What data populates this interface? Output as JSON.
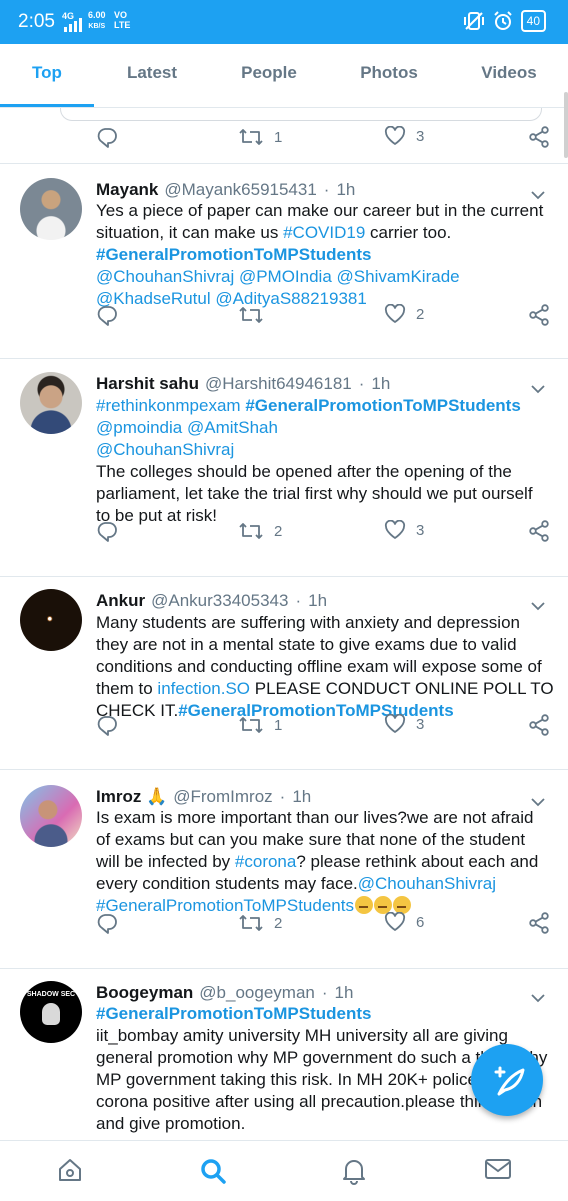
{
  "status_bar": {
    "time": "2:05",
    "network": "4G",
    "speed_value": "6.00",
    "speed_unit": "KB/S",
    "vo": "VO",
    "lte": "LTE",
    "battery": "40"
  },
  "tabs": [
    {
      "label": "Top",
      "active": true
    },
    {
      "label": "Latest",
      "active": false
    },
    {
      "label": "People",
      "active": false
    },
    {
      "label": "Photos",
      "active": false
    },
    {
      "label": "Videos",
      "active": false
    }
  ],
  "previous_tweet": {
    "retweets": "1",
    "likes": "3"
  },
  "tweets": [
    {
      "name": "Mayank",
      "handle": "@Mayank65915431",
      "time": "1h",
      "lines": [
        [
          {
            "t": "Yes a piece of paper can make our career but in the current"
          }
        ],
        [
          {
            "t": "situation, it can make us "
          },
          {
            "t": "#COVID19",
            "c": "ht"
          },
          {
            "t": " carrier too."
          }
        ],
        [
          {
            "t": "#GeneralPromotionToMPStudents",
            "c": "htb"
          }
        ],
        [
          {
            "t": "@ChouhanShivraj @PMOIndia @ShivamKirade",
            "c": "ht"
          }
        ],
        [
          {
            "t": "@KhadseRutul @AdityaS88219381",
            "c": "ht"
          }
        ]
      ],
      "retweets": "",
      "likes": "2"
    },
    {
      "name": "Harshit sahu",
      "handle": "@Harshit64946181",
      "time": "1h",
      "lines": [
        [
          {
            "t": "#rethinkonmpexam ",
            "c": "ht"
          },
          {
            "t": "#GeneralPromotionToMPStudents",
            "c": "htb"
          }
        ],
        [
          {
            "t": "@pmoindia @AmitShah",
            "c": "ht"
          }
        ],
        [
          {
            "t": "@ChouhanShivraj",
            "c": "ht"
          }
        ],
        [
          {
            "t": "The colleges should be opened after the opening of the"
          }
        ],
        [
          {
            "t": "parliament, let take the trial first why should we put ourself"
          }
        ],
        [
          {
            "t": "to be put at risk!"
          }
        ]
      ],
      "retweets": "2",
      "likes": "3"
    },
    {
      "name": "Ankur",
      "handle": "@Ankur33405343",
      "time": "1h",
      "lines": [
        [
          {
            "t": "Many students are suffering with anxiety and depression"
          }
        ],
        [
          {
            "t": "they are not in a mental state to give exams due to valid"
          }
        ],
        [
          {
            "t": "conditions and conducting offline exam will expose some of"
          }
        ],
        [
          {
            "t": "them to "
          },
          {
            "t": "infection.SO",
            "c": "ht"
          },
          {
            "t": " PLEASE CONDUCT ONLINE POLL TO"
          }
        ],
        [
          {
            "t": "CHECK IT."
          },
          {
            "t": "#GeneralPromotionToMPStudents",
            "c": "htb"
          }
        ]
      ],
      "retweets": "1",
      "likes": "3"
    },
    {
      "name": "Imroz 🙏",
      "handle": "@FromImroz",
      "time": "1h",
      "lines": [
        [
          {
            "t": "Is exam is more important than our lives?we are not afraid"
          }
        ],
        [
          {
            "t": "of exams but can you make sure that none of the student"
          }
        ],
        [
          {
            "t": "will be infected by "
          },
          {
            "t": "#corona",
            "c": "ht"
          },
          {
            "t": "? please rethink about each and"
          }
        ],
        [
          {
            "t": "every condition students may face."
          },
          {
            "t": "@ChouhanShivraj",
            "c": "ht"
          }
        ],
        [
          {
            "t": "#GeneralPromotionToMPStudents",
            "c": "ht"
          },
          {
            "t": "🙄🙄🙄",
            "c": "emo"
          }
        ]
      ],
      "retweets": "2",
      "likes": "6"
    },
    {
      "name": "Boogeyman",
      "handle": "@b_oogeyman",
      "time": "1h",
      "avatar_text": "SHADOW SEC",
      "lines": [
        [
          {
            "t": "#GeneralPromotionToMPStudents",
            "c": "htb"
          }
        ],
        [
          {
            "t": "iit_bombay amity university MH university all are giving"
          }
        ],
        [
          {
            "t": "general promotion why MP government do such a thing why"
          }
        ],
        [
          {
            "t": "MP government taking this risk. In MH 20K+ police are"
          }
        ],
        [
          {
            "t": "corona positive after  using all precaution.please think again"
          }
        ],
        [
          {
            "t": "and give promotion."
          }
        ]
      ]
    }
  ],
  "icons": {
    "reply": "reply-icon",
    "retweet": "retweet-icon",
    "like": "heart-icon",
    "share": "share-icon",
    "more": "chevron-down-icon",
    "nav": [
      "home-icon",
      "search-icon",
      "notifications-icon",
      "messages-icon"
    ],
    "fab": "compose-tweet-icon"
  },
  "colors": {
    "accent": "#1da1f2",
    "hashtag": "#1b95e0",
    "muted": "#657786"
  }
}
